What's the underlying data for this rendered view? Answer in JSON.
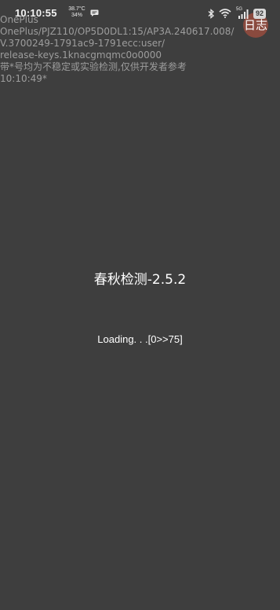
{
  "status_bar": {
    "time": "10:10:55",
    "temperature": "38.7°C",
    "percent": "34%",
    "battery": "92",
    "network_label": "5G"
  },
  "avatar": {
    "text": "日志"
  },
  "build_info": {
    "lines": [
      "OnePlus",
      "OnePlus/PJZ110/OP5D0DL1:15/AP3A.240617.008/",
      "V.3700249-1791ac9-1791ecc:user/",
      "release-keys.1knacgmqmc0o0000",
      "带*号均为不稳定或实验检测,仅供开发者参考",
      "10:10:49*"
    ]
  },
  "main": {
    "title": "春秋检测-2.5.2",
    "loading": "Loading. . .[0>>75]"
  },
  "colors": {
    "background": "#3e3e3e",
    "avatar": "#8a4a3e",
    "info_text": "#9d9d9d"
  }
}
